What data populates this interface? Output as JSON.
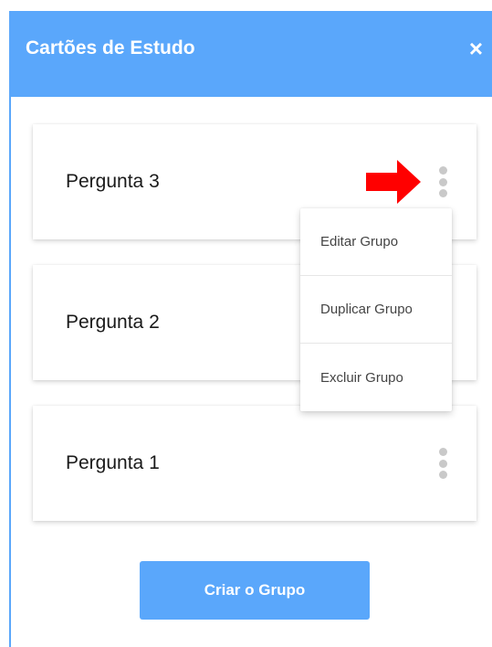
{
  "header": {
    "title": "Cartões de Estudo",
    "close_label": "×"
  },
  "cards": [
    {
      "label": "Pergunta 3"
    },
    {
      "label": "Pergunta 2"
    },
    {
      "label": "Pergunta 1"
    }
  ],
  "context_menu": {
    "items": [
      {
        "label": "Editar Grupo"
      },
      {
        "label": "Duplicar Grupo"
      },
      {
        "label": "Excluir Grupo"
      }
    ]
  },
  "footer": {
    "create_label": "Criar o Grupo"
  },
  "colors": {
    "accent": "#5aa7fb",
    "annotation_arrow": "#ff0000"
  },
  "icons": {
    "close": "close-icon",
    "card_menu": "kebab-menu-icon",
    "annotation": "red-arrow-icon"
  }
}
